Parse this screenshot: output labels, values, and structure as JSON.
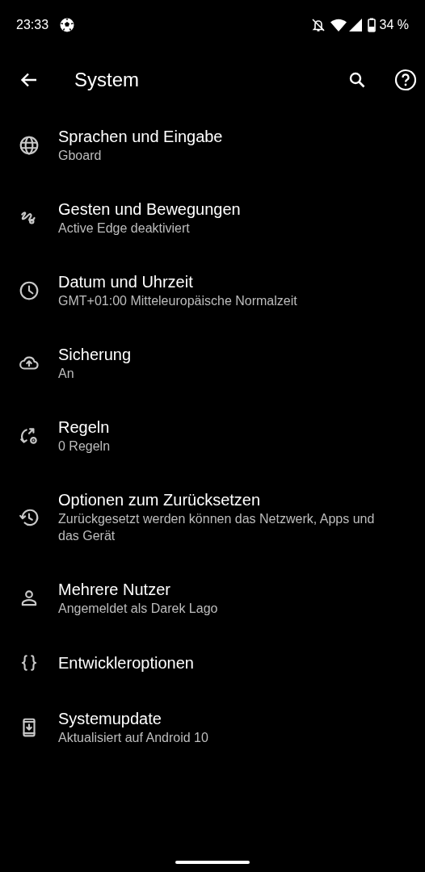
{
  "status_bar": {
    "time": "23:33",
    "battery": "34 %"
  },
  "toolbar": {
    "title": "System"
  },
  "items": [
    {
      "title": "Sprachen und Eingabe",
      "summary": "Gboard"
    },
    {
      "title": "Gesten und Bewegungen",
      "summary": "Active Edge deaktiviert"
    },
    {
      "title": "Datum und Uhrzeit",
      "summary": "GMT+01:00 Mitteleuropäische Normalzeit"
    },
    {
      "title": "Sicherung",
      "summary": "An"
    },
    {
      "title": "Regeln",
      "summary": "0 Regeln"
    },
    {
      "title": "Optionen zum Zurücksetzen",
      "summary": "Zurückgesetzt werden können das Netzwerk, Apps und das Gerät"
    },
    {
      "title": "Mehrere Nutzer",
      "summary": "Angemeldet als Darek Lago"
    },
    {
      "title": "Entwickleroptionen"
    },
    {
      "title": "Systemupdate",
      "summary": "Aktualisiert auf Android 10"
    }
  ]
}
